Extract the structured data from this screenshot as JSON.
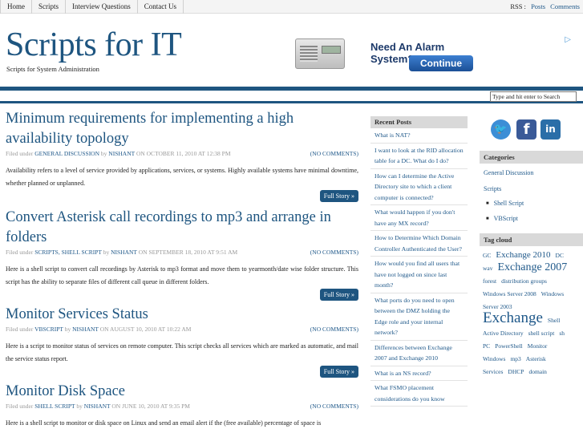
{
  "nav": {
    "items": [
      "Home",
      "Scripts",
      "Interview Questions",
      "Contact Us"
    ],
    "rss_label": "RSS :",
    "rss_posts": "Posts",
    "rss_comments": "Comments"
  },
  "header": {
    "title": "Scripts for IT",
    "description": "Scripts for System Administration"
  },
  "ad": {
    "headline": "Need An Alarm System?",
    "cta": "Continue",
    "choice_icon": "ad-choices-icon"
  },
  "search": {
    "placeholder": "Type and hit enter to Search"
  },
  "posts": [
    {
      "title": "Minimum requirements for implementing a high availability topology",
      "filed": "Filed under",
      "categories": "General Discussion",
      "by": "by",
      "author": "nishant",
      "on": "on October 11, 2010 at 12:38 pm",
      "comments": "(No Comments)",
      "excerpt": "Availability refers to a level of service provided by applications, services, or systems. Highly available systems have minimal downtime, whether planned or unplanned.",
      "more": "Full Story »"
    },
    {
      "title": "Convert Asterisk call recordings to mp3 and arrange in folders",
      "filed": "Filed under",
      "categories": "Scripts, Shell Script",
      "by": "by",
      "author": "nishant",
      "on": "on September 18, 2010 at 9:51 am",
      "comments": "(No Comments)",
      "excerpt": "Here is a shell script to convert call recordings by Asterisk to mp3 format and move them to yearmonth/date wise folder structure. This script has the ability to separate files of different call queue in different folders.",
      "more": "Full Story »"
    },
    {
      "title": "Monitor Services Status",
      "filed": "Filed under",
      "categories": "VBScript",
      "by": "by",
      "author": "nishant",
      "on": "on August 10, 2010 at 10:22 am",
      "comments": "(No Comments)",
      "excerpt": "Here is a script to monitor status of services on remote computer. This script checks all services which are marked as automatic, and mail the service status report.",
      "more": "Full Story »"
    },
    {
      "title": "Monitor Disk Space",
      "filed": "Filed under",
      "categories": "Shell Script",
      "by": "by",
      "author": "nishant",
      "on": "on June 10, 2010 at 9:35 pm",
      "comments": "(No Comments)",
      "excerpt": "Here is a shell script to monitor or disk space on Linux and send an email alert if the (free available) percentage of space is",
      "more": ""
    }
  ],
  "recent": {
    "heading": "Recent Posts",
    "items": [
      "What is NAT?",
      "I want to look at the RID allocation table for a DC. What do I do?",
      "How can I determine the Active Directory site to which a client computer is connected?",
      "What would happen if you don't have any MX record?",
      "How to Determine Which Domain Controller Authenticated the User?",
      "How would you find all users that have not logged on since last month?",
      "What ports do you need to open between the DMZ holding the Edge role and your internal network?",
      "Differences between Exchange 2007 and Exchange 2010",
      "What is an NS record?",
      "What FSMO placement considerations do you know"
    ]
  },
  "sidebar": {
    "social_icons": [
      "twitter-icon",
      "facebook-icon",
      "linkedin-icon"
    ],
    "categories_heading": "Categories",
    "categories": [
      "General Discussion",
      "Scripts"
    ],
    "subcategories": [
      "Shell Script",
      "VBScript"
    ],
    "tags_heading": "Tag cloud",
    "tags": [
      {
        "t": "GC",
        "s": "t-s"
      },
      {
        "t": "Exchange 2010",
        "s": "t-m"
      },
      {
        "t": "DC",
        "s": "t-s"
      },
      {
        "t": "wav",
        "s": "t-s"
      },
      {
        "t": "Exchange 2007",
        "s": "t-l"
      },
      {
        "t": "forest",
        "s": "t-s"
      },
      {
        "t": "distribution groups",
        "s": "t-s"
      },
      {
        "t": "Windows Server 2008",
        "s": "t-s"
      },
      {
        "t": "Windows Server 2003",
        "s": "t-s"
      },
      {
        "t": "Exchange",
        "s": "t-xl"
      },
      {
        "t": "Shell",
        "s": "t-s"
      },
      {
        "t": "Active Directory",
        "s": "t-s"
      },
      {
        "t": "shell script",
        "s": "t-s"
      },
      {
        "t": "sh",
        "s": "t-s"
      },
      {
        "t": "PC",
        "s": "t-s"
      },
      {
        "t": "PowerShell",
        "s": "t-s"
      },
      {
        "t": "Monitor",
        "s": "t-s"
      },
      {
        "t": "Windows",
        "s": "t-s"
      },
      {
        "t": "mp3",
        "s": "t-s"
      },
      {
        "t": "Asterisk",
        "s": "t-s"
      },
      {
        "t": "Services",
        "s": "t-s"
      },
      {
        "t": "DHCP",
        "s": "t-s"
      },
      {
        "t": "domain",
        "s": "t-s"
      }
    ]
  }
}
